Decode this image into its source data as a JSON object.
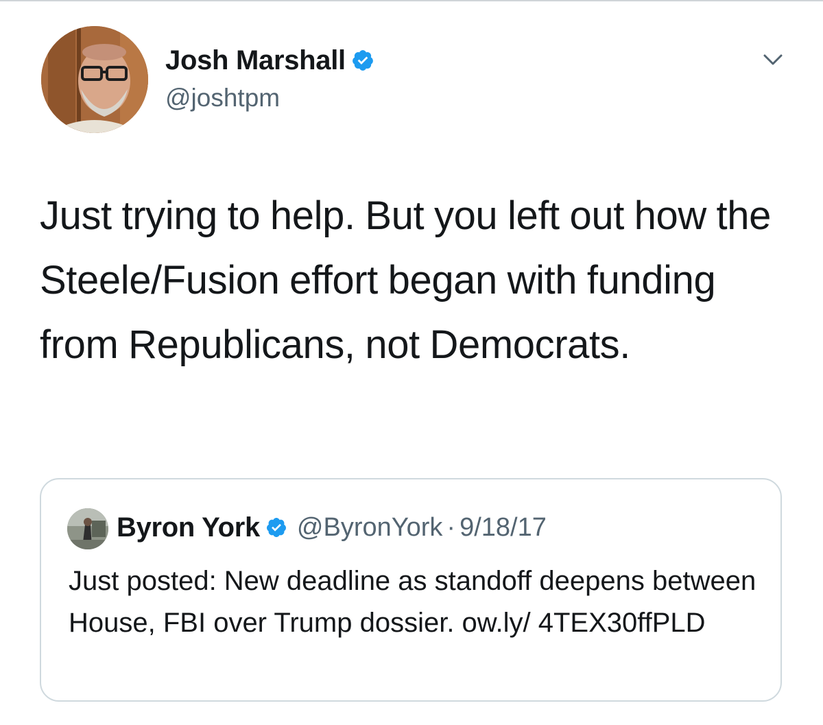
{
  "tweet": {
    "author": {
      "display_name": "Josh Marshall",
      "handle": "@joshtpm",
      "verified": true
    },
    "text": "Just trying to help. But you left out how the Steele/Fusion effort began with funding from Republicans, not Democrats.",
    "menu_icon": "chevron-down-icon"
  },
  "quoted_tweet": {
    "author": {
      "display_name": "Byron York",
      "handle": "@ByronYork",
      "verified": true
    },
    "separator": "·",
    "date": "9/18/17",
    "text": "Just posted: New deadline as standoff deepens between House, FBI over Trump dossier. ow.ly/ 4TEX30ffPLD"
  },
  "colors": {
    "verified_badge": "#1d9bf0",
    "secondary_text": "#536471",
    "primary_text": "#14171a",
    "card_border": "#cfd9de"
  }
}
